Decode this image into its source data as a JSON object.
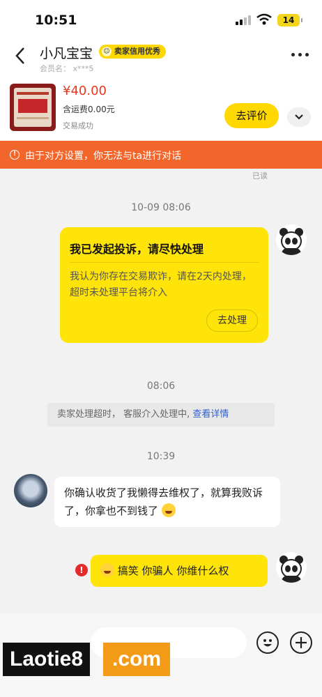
{
  "status": {
    "time": "10:51",
    "battery": "14"
  },
  "header": {
    "name": "小凡宝宝",
    "badge": "卖家信用优秀",
    "member": "会员名： x***5"
  },
  "product": {
    "price": "¥40.00",
    "shipping": "含运费0.00元",
    "status": "交易成功",
    "review_button": "去评价"
  },
  "banner": {
    "text": "由于对方设置，你无法与ta进行对话"
  },
  "read_label": "已读",
  "messages": {
    "ts1": "10-09 08:06",
    "card_title": "我已发起投诉，请尽快处理",
    "card_body": "我认为你存在交易欺诈，请在2天内处理，超时未处理平台将介入",
    "card_action": "去处理",
    "ts2": "08:06",
    "system_text": "卖家处理超时， 客服介入处理中,",
    "system_link": "查看详情",
    "ts3": "10:39",
    "incoming": "你确认收货了我懒得去维权了，就算我败诉了，你拿也不到钱了",
    "outgoing": "搞笑 你骗人 你维什么权"
  },
  "watermark": {
    "left": "Laotie8",
    "right": ".com"
  },
  "colors": {
    "brand_yellow": "#ffe40a",
    "banner_orange": "#f2652b",
    "price_red": "#e8361c",
    "link_blue": "#2c5fd6"
  }
}
